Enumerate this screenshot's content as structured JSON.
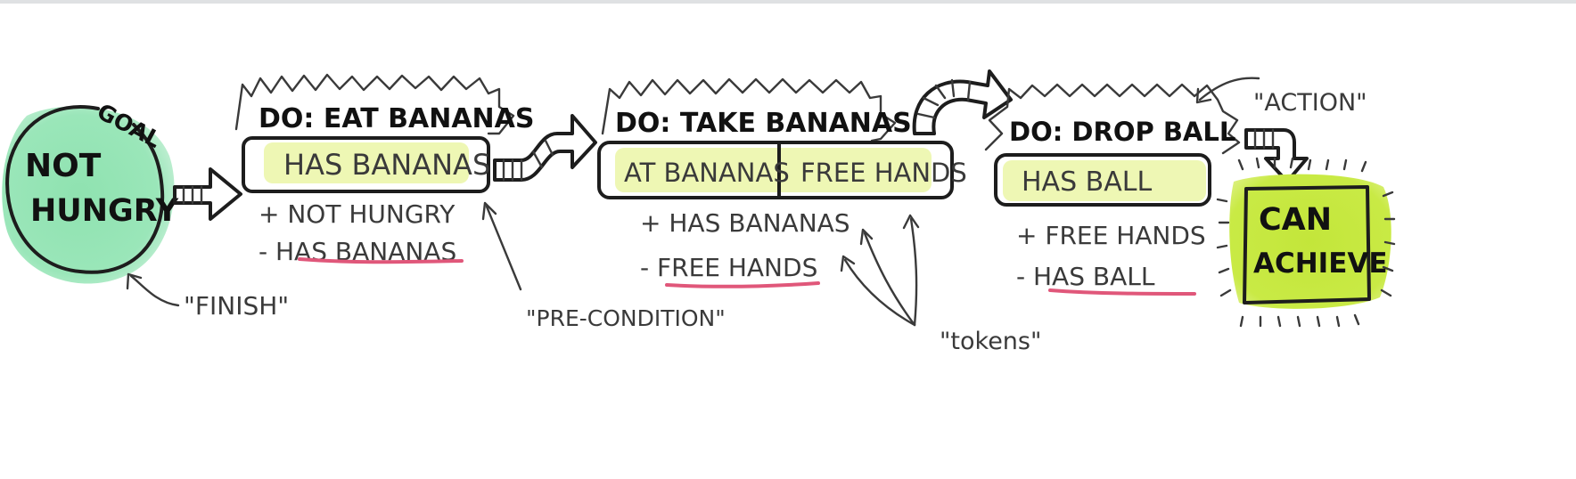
{
  "goal": {
    "tag": "GOAL",
    "line1": "NOT",
    "line2": "HUNGRY",
    "fill": "#8fe2b0",
    "caption": "\"FINISH\""
  },
  "actions": [
    {
      "title": "DO: EAT BANANAS",
      "preconditions": [
        "HAS BANANAS"
      ],
      "effects": [
        "+ NOT HUNGRY",
        "- HAS BANANAS"
      ]
    },
    {
      "title": "DO: TAKE BANANAS",
      "preconditions": [
        "AT BANANAS",
        "FREE HANDS"
      ],
      "effects": [
        "+ HAS BANANAS",
        "- FREE HANDS"
      ]
    },
    {
      "title": "DO: DROP BALL",
      "preconditions": [
        "HAS BALL"
      ],
      "effects": [
        "+ FREE HANDS",
        "- HAS BALL"
      ]
    }
  ],
  "start": {
    "line1": "CAN",
    "line2": "ACHIEVE",
    "fill": "#c3e63a"
  },
  "labels": {
    "action": "\"ACTION\"",
    "precondition": "\"PRE-CONDITION\"",
    "tokens": "\"tokens\""
  },
  "colors": {
    "highlight": "#eef7b4",
    "underline": "#e0577a",
    "ink": "#1d1d1d"
  }
}
